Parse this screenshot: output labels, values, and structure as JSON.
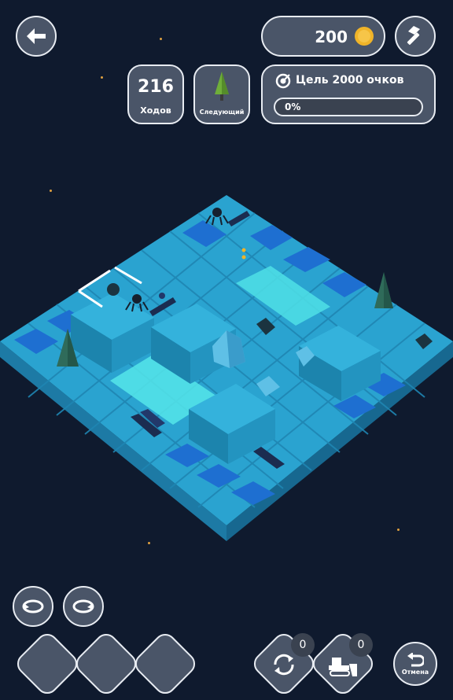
{
  "header": {
    "coins": "200",
    "moves_count": "216",
    "moves_label": "Ходов",
    "next_label": "Следующий",
    "goal_label": "Цель 2000 очков",
    "goal_progress_text": "0%",
    "goal_progress": 0
  },
  "tools": {
    "shuffle_count": "0",
    "bulldozer_count": "0",
    "undo_label": "Отмена"
  },
  "colors": {
    "background": "#0f1a2e",
    "board": "#2aa3d0",
    "button": "#4a5568",
    "coin": "#f0b429"
  }
}
